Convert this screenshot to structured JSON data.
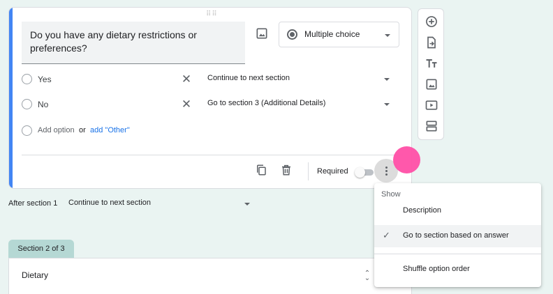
{
  "question": {
    "title": "Do you have any dietary restrictions or preferences?",
    "type_label": "Multiple choice",
    "options": [
      {
        "label": "Yes",
        "goto": "Continue to next section"
      },
      {
        "label": "No",
        "goto": "Go to section 3 (Additional Details)"
      }
    ],
    "add_option": "Add option",
    "or": "or",
    "add_other": "add \"Other\"",
    "required_label": "Required",
    "required_on": false
  },
  "after_section": {
    "label": "After section 1",
    "value": "Continue to next section"
  },
  "next_section": {
    "tab": "Section 2 of 3",
    "title": "Dietary"
  },
  "menu": {
    "header": "Show",
    "items": [
      {
        "label": "Description",
        "checked": false
      },
      {
        "label": "Go to section based on answer",
        "checked": true
      },
      {
        "label": "Shuffle option order",
        "checked": false
      }
    ]
  },
  "toolbar_icons": [
    "add-question-icon",
    "import-questions-icon",
    "add-title-icon",
    "add-image-icon",
    "add-video-icon",
    "add-section-icon"
  ],
  "colors": {
    "accent": "#4285f4",
    "link": "#1a73e8",
    "background": "#eaf4f2",
    "section_tab": "#b5d8d4",
    "cursor": "#ff4fa7"
  }
}
